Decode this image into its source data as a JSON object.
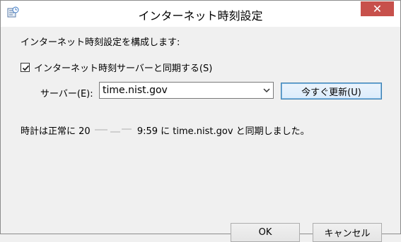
{
  "window": {
    "title": "インターネット時刻設定",
    "close_label": "✕"
  },
  "dialog": {
    "heading": "インターネット時刻設定を構成します:",
    "sync_checkbox": {
      "checked": true,
      "label": "インターネット時刻サーバーと同期する(S)"
    },
    "server": {
      "label": "サーバー(E):",
      "value": "time.nist.gov",
      "options": [
        "time.nist.gov"
      ]
    },
    "update_button": "今すぐ更新(U)",
    "status": {
      "prefix": "時計は正常に 20",
      "suffix": " 9:59 に time.nist.gov と同期しました。"
    },
    "ok_button": "OK",
    "cancel_button": "キャンセル"
  }
}
